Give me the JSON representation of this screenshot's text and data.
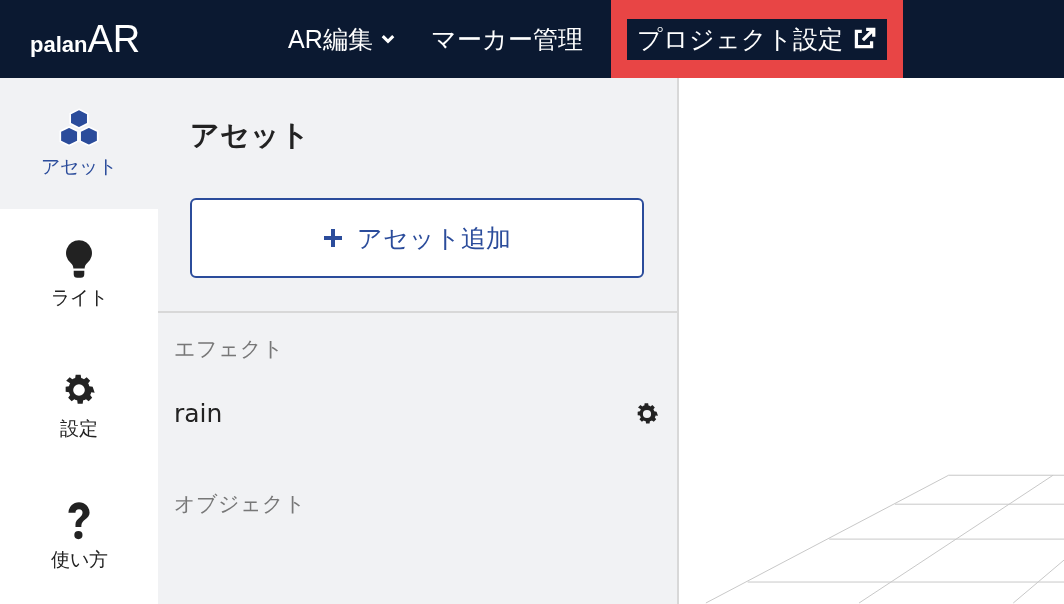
{
  "header": {
    "logo": {
      "prefix": "palan",
      "suffix": "AR"
    },
    "nav": [
      {
        "label": "AR編集",
        "kind": "dropdown",
        "highlighted": false
      },
      {
        "label": "マーカー管理",
        "kind": "link",
        "highlighted": false
      },
      {
        "label": "プロジェクト設定",
        "kind": "external",
        "highlighted": true
      }
    ]
  },
  "rail": [
    {
      "label": "アセット",
      "kind": "cubes",
      "selected": true
    },
    {
      "label": "ライト",
      "kind": "bulb",
      "selected": false
    },
    {
      "label": "設定",
      "kind": "gear",
      "selected": false
    },
    {
      "label": "使い方",
      "kind": "question",
      "selected": false
    }
  ],
  "panel": {
    "title": "アセット",
    "add_button": "アセット追加",
    "sections": [
      {
        "label": "エフェクト",
        "items": [
          "rain"
        ]
      },
      {
        "label": "オブジェクト"
      }
    ]
  }
}
